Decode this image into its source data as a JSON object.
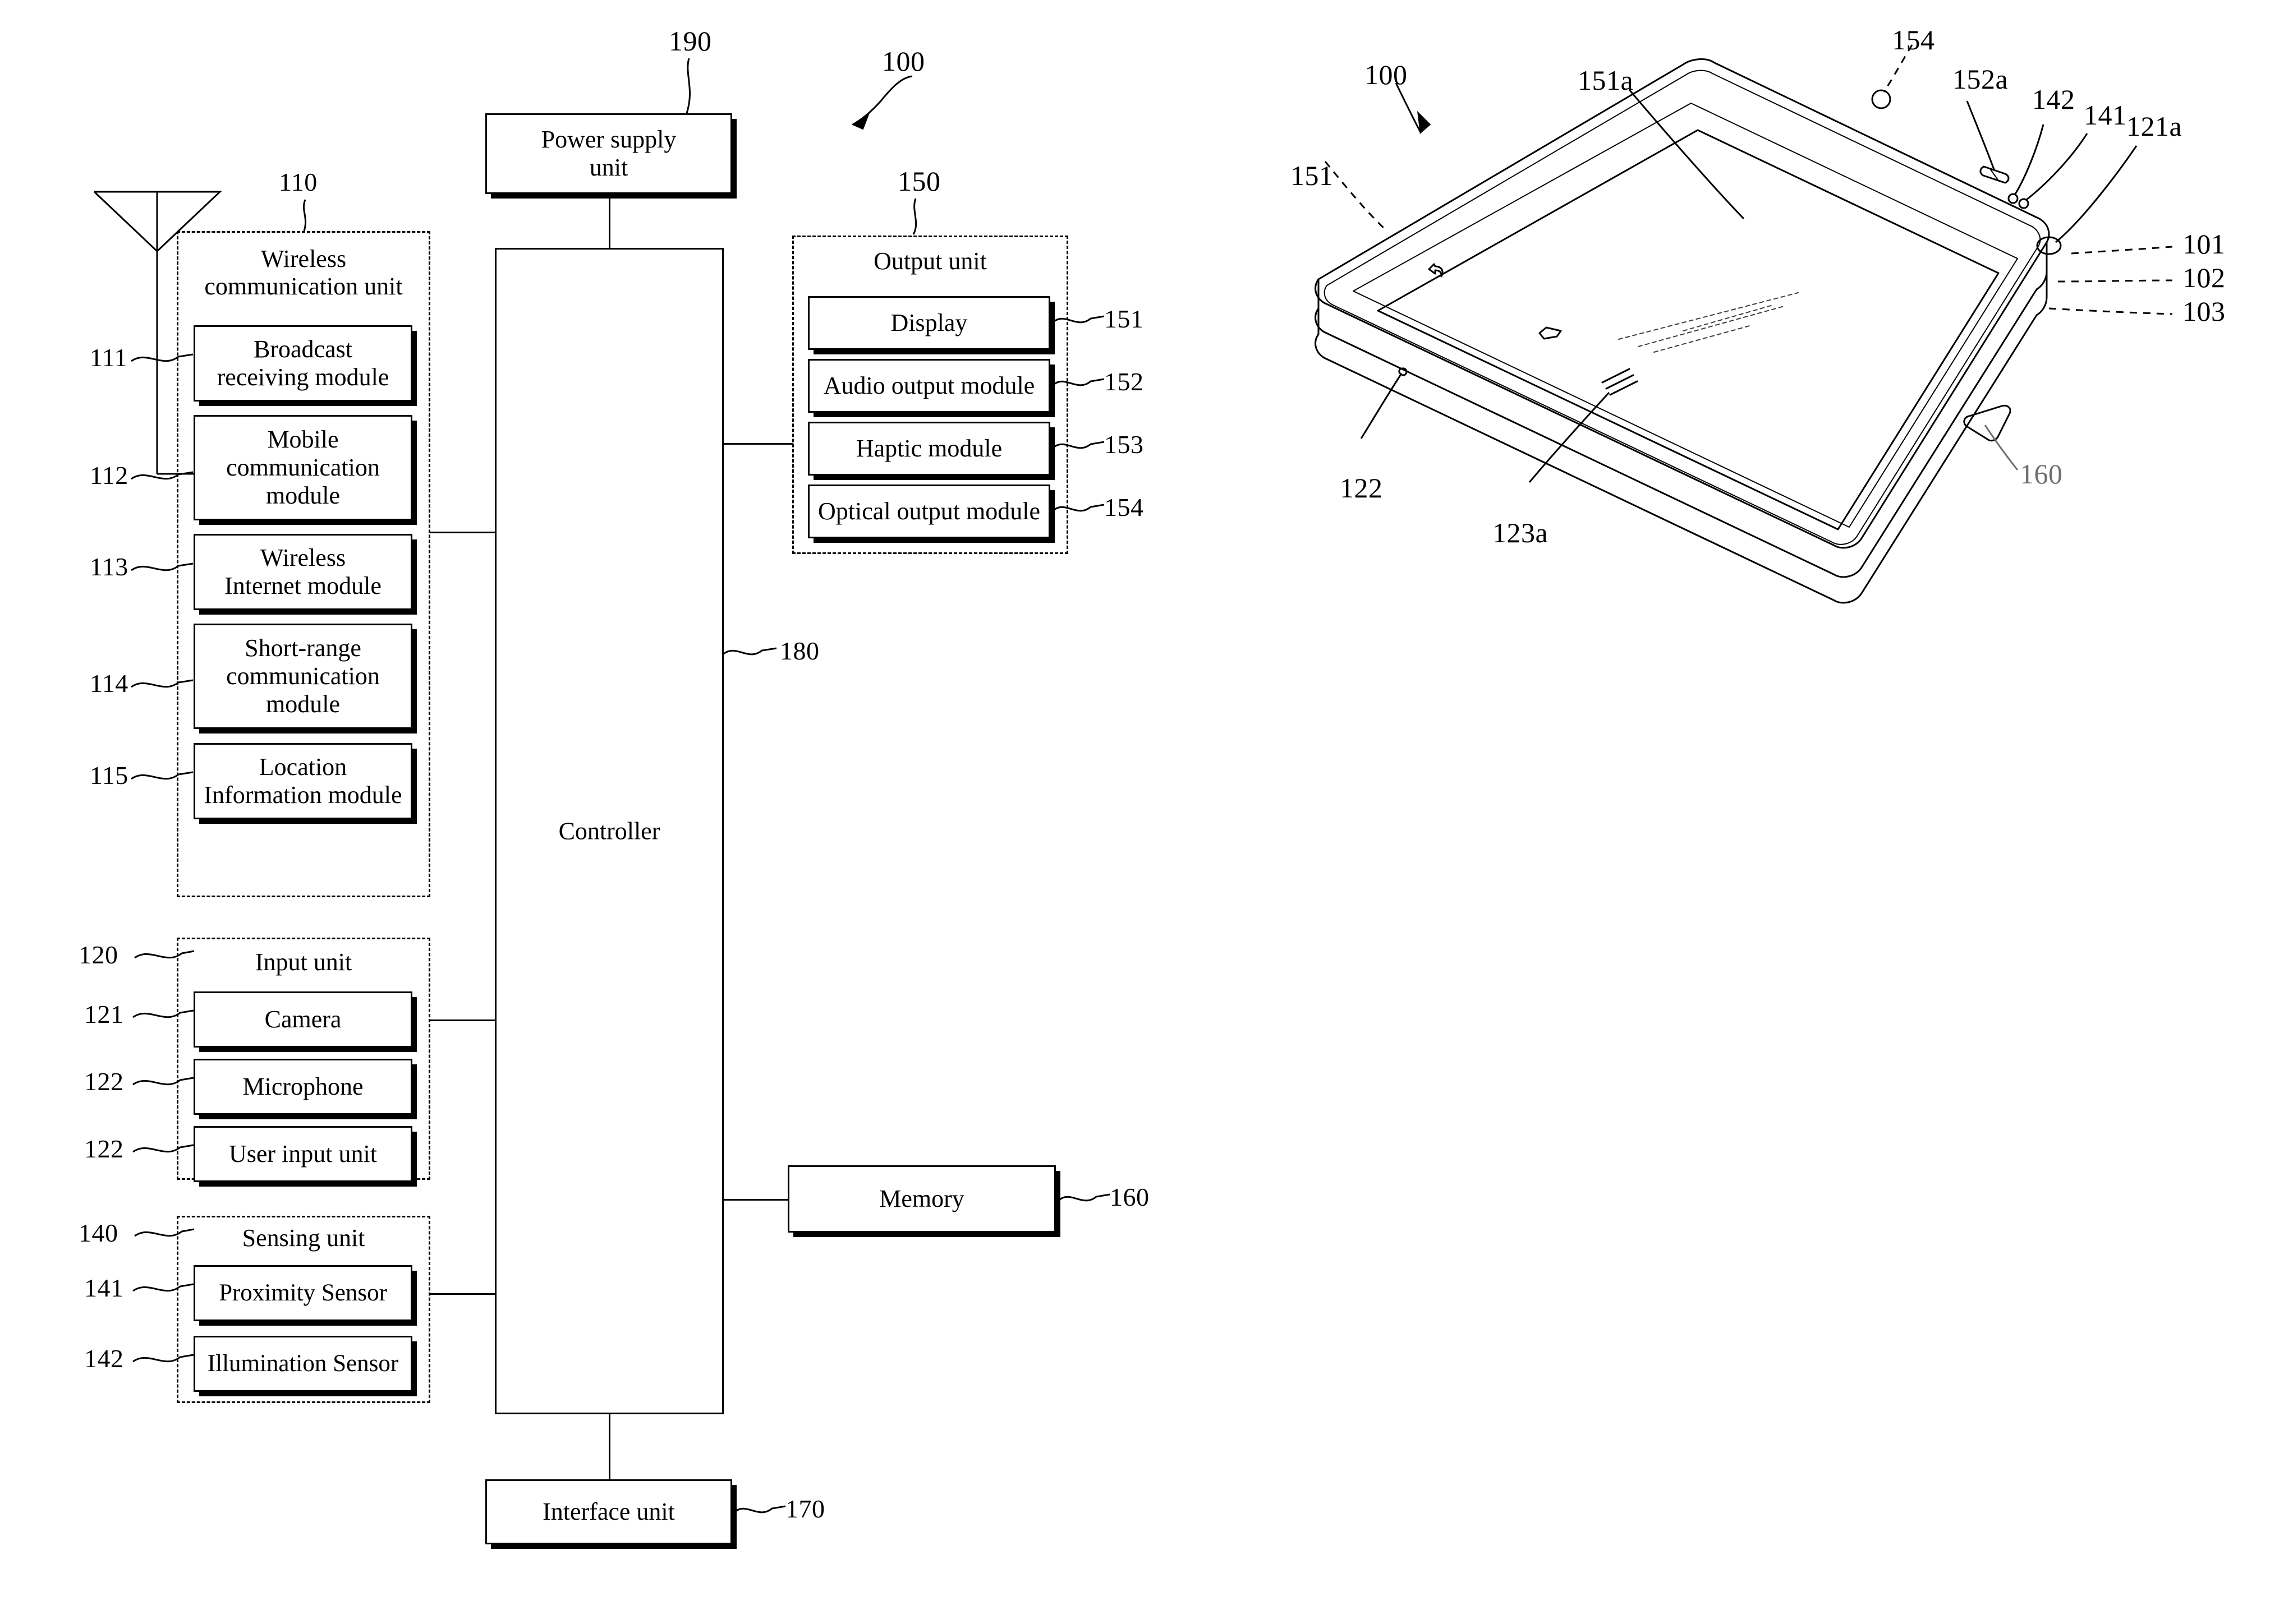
{
  "figure": {
    "title": "Mobile terminal block diagram and perspective view",
    "line_color": "#000000",
    "background": "#ffffff"
  },
  "block_diagram": {
    "antenna": {
      "name": "antenna-symbol"
    },
    "power_supply": {
      "label": "Power supply\nunit",
      "ref": "190"
    },
    "device_ref": "100",
    "controller": {
      "label": "Controller",
      "ref": "180"
    },
    "memory": {
      "label": "Memory",
      "ref": "160"
    },
    "interface": {
      "label": "Interface unit",
      "ref": "170"
    },
    "wireless_unit": {
      "title": "Wireless\ncommunication unit",
      "ref": "110",
      "modules": [
        {
          "label": "Broadcast\nreceiving module",
          "ref": "111"
        },
        {
          "label": "Mobile\ncommunication\nmodule",
          "ref": "112"
        },
        {
          "label": "Wireless\nInternet module",
          "ref": "113"
        },
        {
          "label": "Short-range\ncommunication\nmodule",
          "ref": "114"
        },
        {
          "label": "Location\nInformation module",
          "ref": "115"
        }
      ]
    },
    "input_unit": {
      "title": "Input unit",
      "ref": "120",
      "modules": [
        {
          "label": "Camera",
          "ref": "121"
        },
        {
          "label": "Microphone",
          "ref": "122"
        },
        {
          "label": "User input unit",
          "ref": "122"
        }
      ]
    },
    "sensing_unit": {
      "title": "Sensing unit",
      "ref": "140",
      "modules": [
        {
          "label": "Proximity Sensor",
          "ref": "141"
        },
        {
          "label": "Illumination Sensor",
          "ref": "142"
        }
      ]
    },
    "output_unit": {
      "title": "Output unit",
      "ref": "150",
      "modules": [
        {
          "label": "Display",
          "ref": "151"
        },
        {
          "label": "Audio output module",
          "ref": "152"
        },
        {
          "label": "Haptic module",
          "ref": "153"
        },
        {
          "label": "Optical output module",
          "ref": "154"
        }
      ]
    }
  },
  "phone_view": {
    "callouts": [
      {
        "ref": "100",
        "name": "device-callout"
      },
      {
        "ref": "151",
        "name": "display-callout"
      },
      {
        "ref": "151a",
        "name": "display-area-callout"
      },
      {
        "ref": "154",
        "name": "optical-output-callout"
      },
      {
        "ref": "152a",
        "name": "audio-output-hole-callout"
      },
      {
        "ref": "142",
        "name": "illumination-sensor-callout"
      },
      {
        "ref": "141",
        "name": "proximity-sensor-callout"
      },
      {
        "ref": "121a",
        "name": "front-camera-callout"
      },
      {
        "ref": "101",
        "name": "front-case-callout"
      },
      {
        "ref": "102",
        "name": "middle-case-callout"
      },
      {
        "ref": "103",
        "name": "rear-case-callout"
      },
      {
        "ref": "160",
        "name": "side-key-callout"
      },
      {
        "ref": "122",
        "name": "microphone-callout"
      },
      {
        "ref": "123a",
        "name": "user-input-callout"
      }
    ]
  }
}
